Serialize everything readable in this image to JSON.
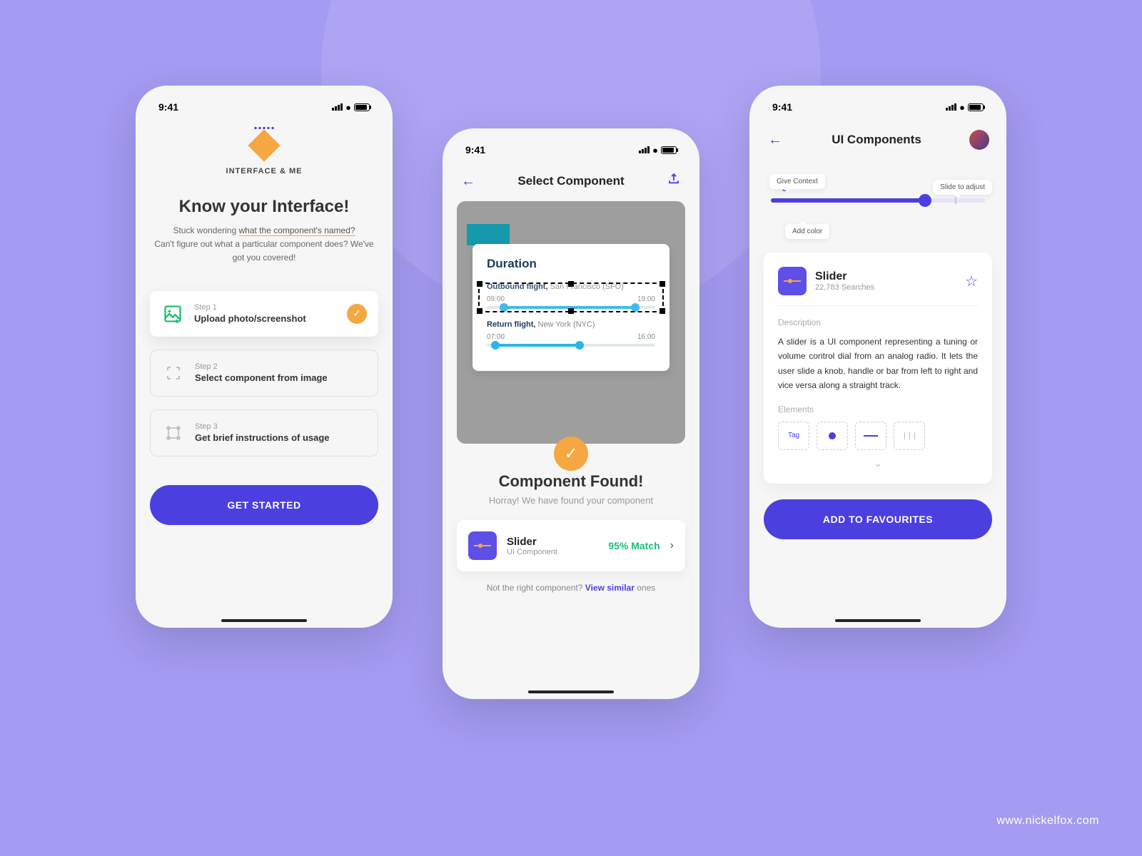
{
  "status_time": "9:41",
  "phone1": {
    "brand": "INTERFACE & ME",
    "title": "Know your Interface!",
    "subtitle_pre": "Stuck  wondering ",
    "subtitle_underline": "what the component's named?",
    "subtitle_post": " Can't figure out what a particular component does? We've got you covered!",
    "steps": [
      {
        "label": "Step 1",
        "text": "Upload photo/screenshot"
      },
      {
        "label": "Step 2",
        "text": "Select component from image"
      },
      {
        "label": "Step 3",
        "text": "Get brief instructions of usage"
      }
    ],
    "cta": "GET STARTED"
  },
  "phone2": {
    "nav_title": "Select Component",
    "image": {
      "card_title": "Duration",
      "outbound_label": "Outbound flight,",
      "outbound_city": " San Francisco (SFO)",
      "outbound_start": "09:00",
      "outbound_end": "19:00",
      "return_label": "Return flight,",
      "return_city": " New York (NYC)",
      "return_start": "07:00",
      "return_end": "16:00"
    },
    "found_title": "Component Found!",
    "found_sub": "Horray! We have found your component",
    "result": {
      "name": "Slider",
      "type": "UI Component",
      "match": "95% Match"
    },
    "footer_pre": "Not the right component? ",
    "footer_link": "View similar",
    "footer_post": " ones"
  },
  "phone3": {
    "nav_title": "UI Components",
    "tooltips": {
      "t1": "Give Context",
      "t2": "Slide to adjust",
      "t3": "Add color"
    },
    "tag_label": "Tag",
    "card": {
      "name": "Slider",
      "meta": "22,783 Searches",
      "desc_label": "Description",
      "desc": "A slider is a UI component representing a tuning or volume control dial from an analog radio. It lets the user slide a knob, handle or bar from left to right and vice versa along a straight track.",
      "elem_label": "Elements",
      "elem_tag": "Tag"
    },
    "cta": "ADD TO FAVOURITES"
  },
  "watermark": "www.nickelfox.com"
}
